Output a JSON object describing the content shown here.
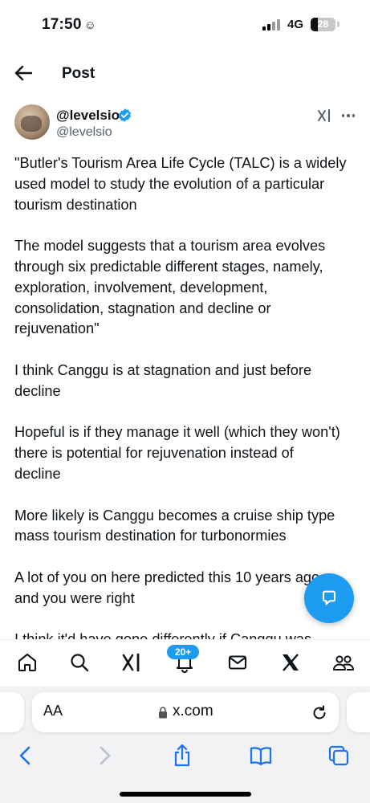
{
  "status_bar": {
    "time": "17:50",
    "time_emoji": "☺",
    "network": "4G",
    "battery": "28",
    "battery_level": 0.28
  },
  "header": {
    "title": "Post"
  },
  "author": {
    "display_name": "@levelsio",
    "handle": "@levelsio",
    "verified": true
  },
  "post": {
    "paragraphs": [
      "\"Butler's Tourism Area Life Cycle (TALC) is a widely\nused model to study the evolution of a particular\ntourism destination",
      "The model suggests that a tourism area evolves\nthrough six predictable different stages, namely,\nexploration, involvement, development,\nconsolidation, stagnation and decline or\nrejuvenation\"",
      "I think Canggu is at stagnation and just before\ndecline",
      "Hopeful is if they manage it well (which they won't)\nthere is potential for rejuvenation instead of\ndecline",
      "More likely is Canggu becomes a cruise ship type\nmass tourism destination for turbonormies",
      "A lot of you on here predicted this 10 years ago\nand you were right",
      "I think it'd have gone differently if Canggu was"
    ]
  },
  "bottom_nav": {
    "items": [
      "home",
      "search",
      "grok",
      "notifications",
      "messages",
      "x",
      "communities"
    ],
    "notification_badge": "20+"
  },
  "safari": {
    "aa_label": "AA",
    "url": "x.com"
  },
  "colors": {
    "accent": "#1d9bf0",
    "text": "#0f1419",
    "secondary_text": "#536471",
    "safari_blue": "#1a73e8"
  }
}
